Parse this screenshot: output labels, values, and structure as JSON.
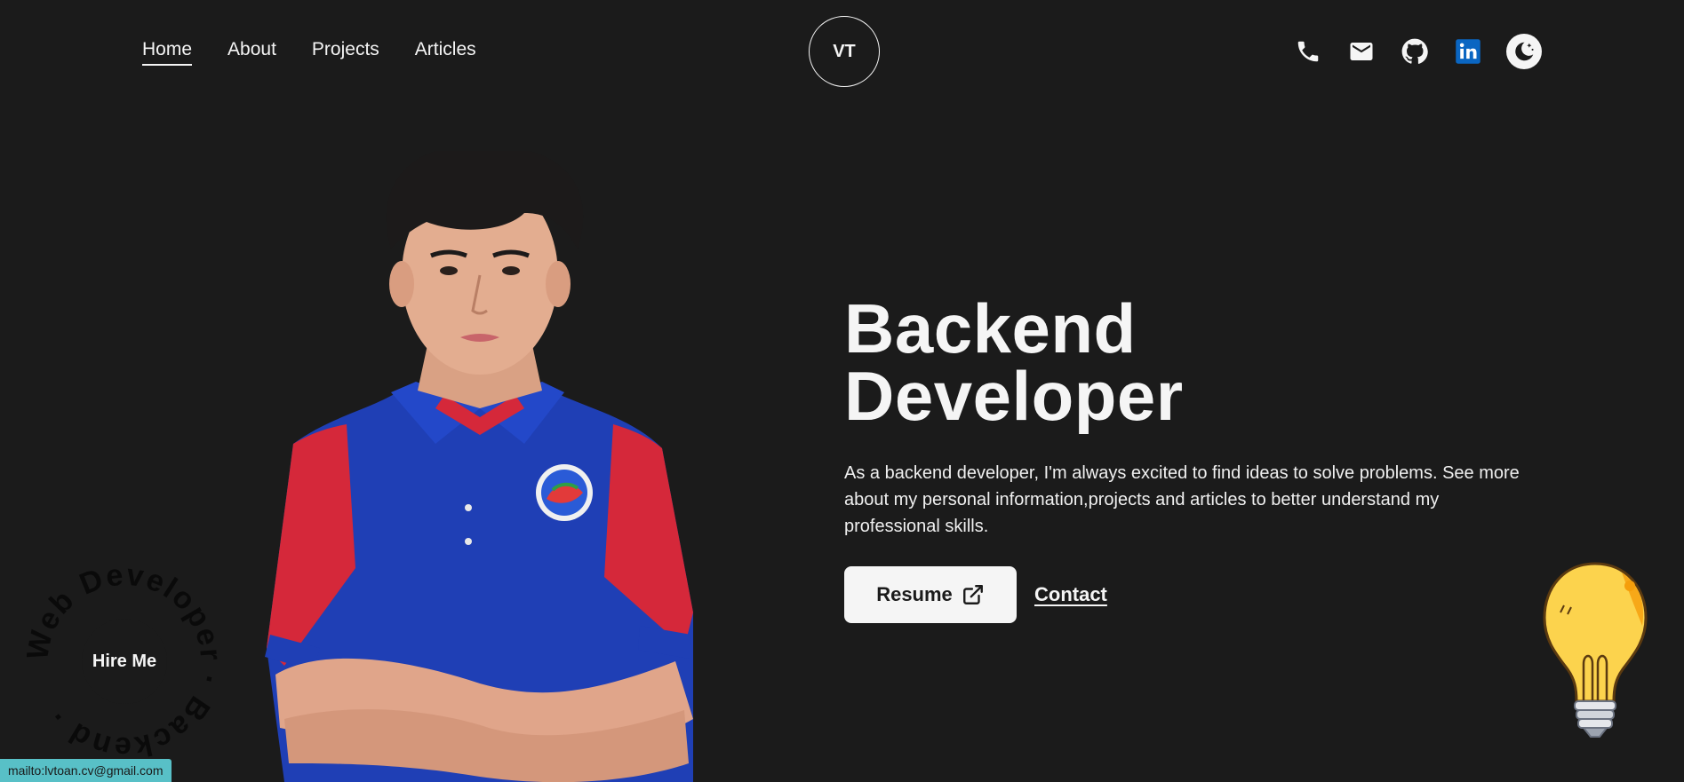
{
  "nav": {
    "items": [
      {
        "label": "Home",
        "active": true
      },
      {
        "label": "About",
        "active": false
      },
      {
        "label": "Projects",
        "active": false
      },
      {
        "label": "Articles",
        "active": false
      }
    ]
  },
  "logo": {
    "text": "VT"
  },
  "socials": {
    "icons": [
      "phone-icon",
      "mail-icon",
      "github-icon",
      "linkedin-icon",
      "moon-icon"
    ]
  },
  "hero": {
    "title_line1": "Backend",
    "title_line2": "Developer",
    "description": "As a backend developer, I'm always excited to find ideas to solve problems. See more about my personal information,projects and articles to better understand my professional skills.",
    "resume_label": "Resume",
    "contact_label": "Contact"
  },
  "hire": {
    "label": "Hire Me",
    "ring_text": "Web Developer · Backend ·"
  },
  "status_bar": {
    "url": "mailto:lvtoan.cv@gmail.com"
  },
  "colors": {
    "background": "#1b1b1b",
    "text": "#f5f5f5",
    "linkedin": "#0a66c2",
    "status_bar": "#58c0c7",
    "bulb": "#fcd34d"
  }
}
